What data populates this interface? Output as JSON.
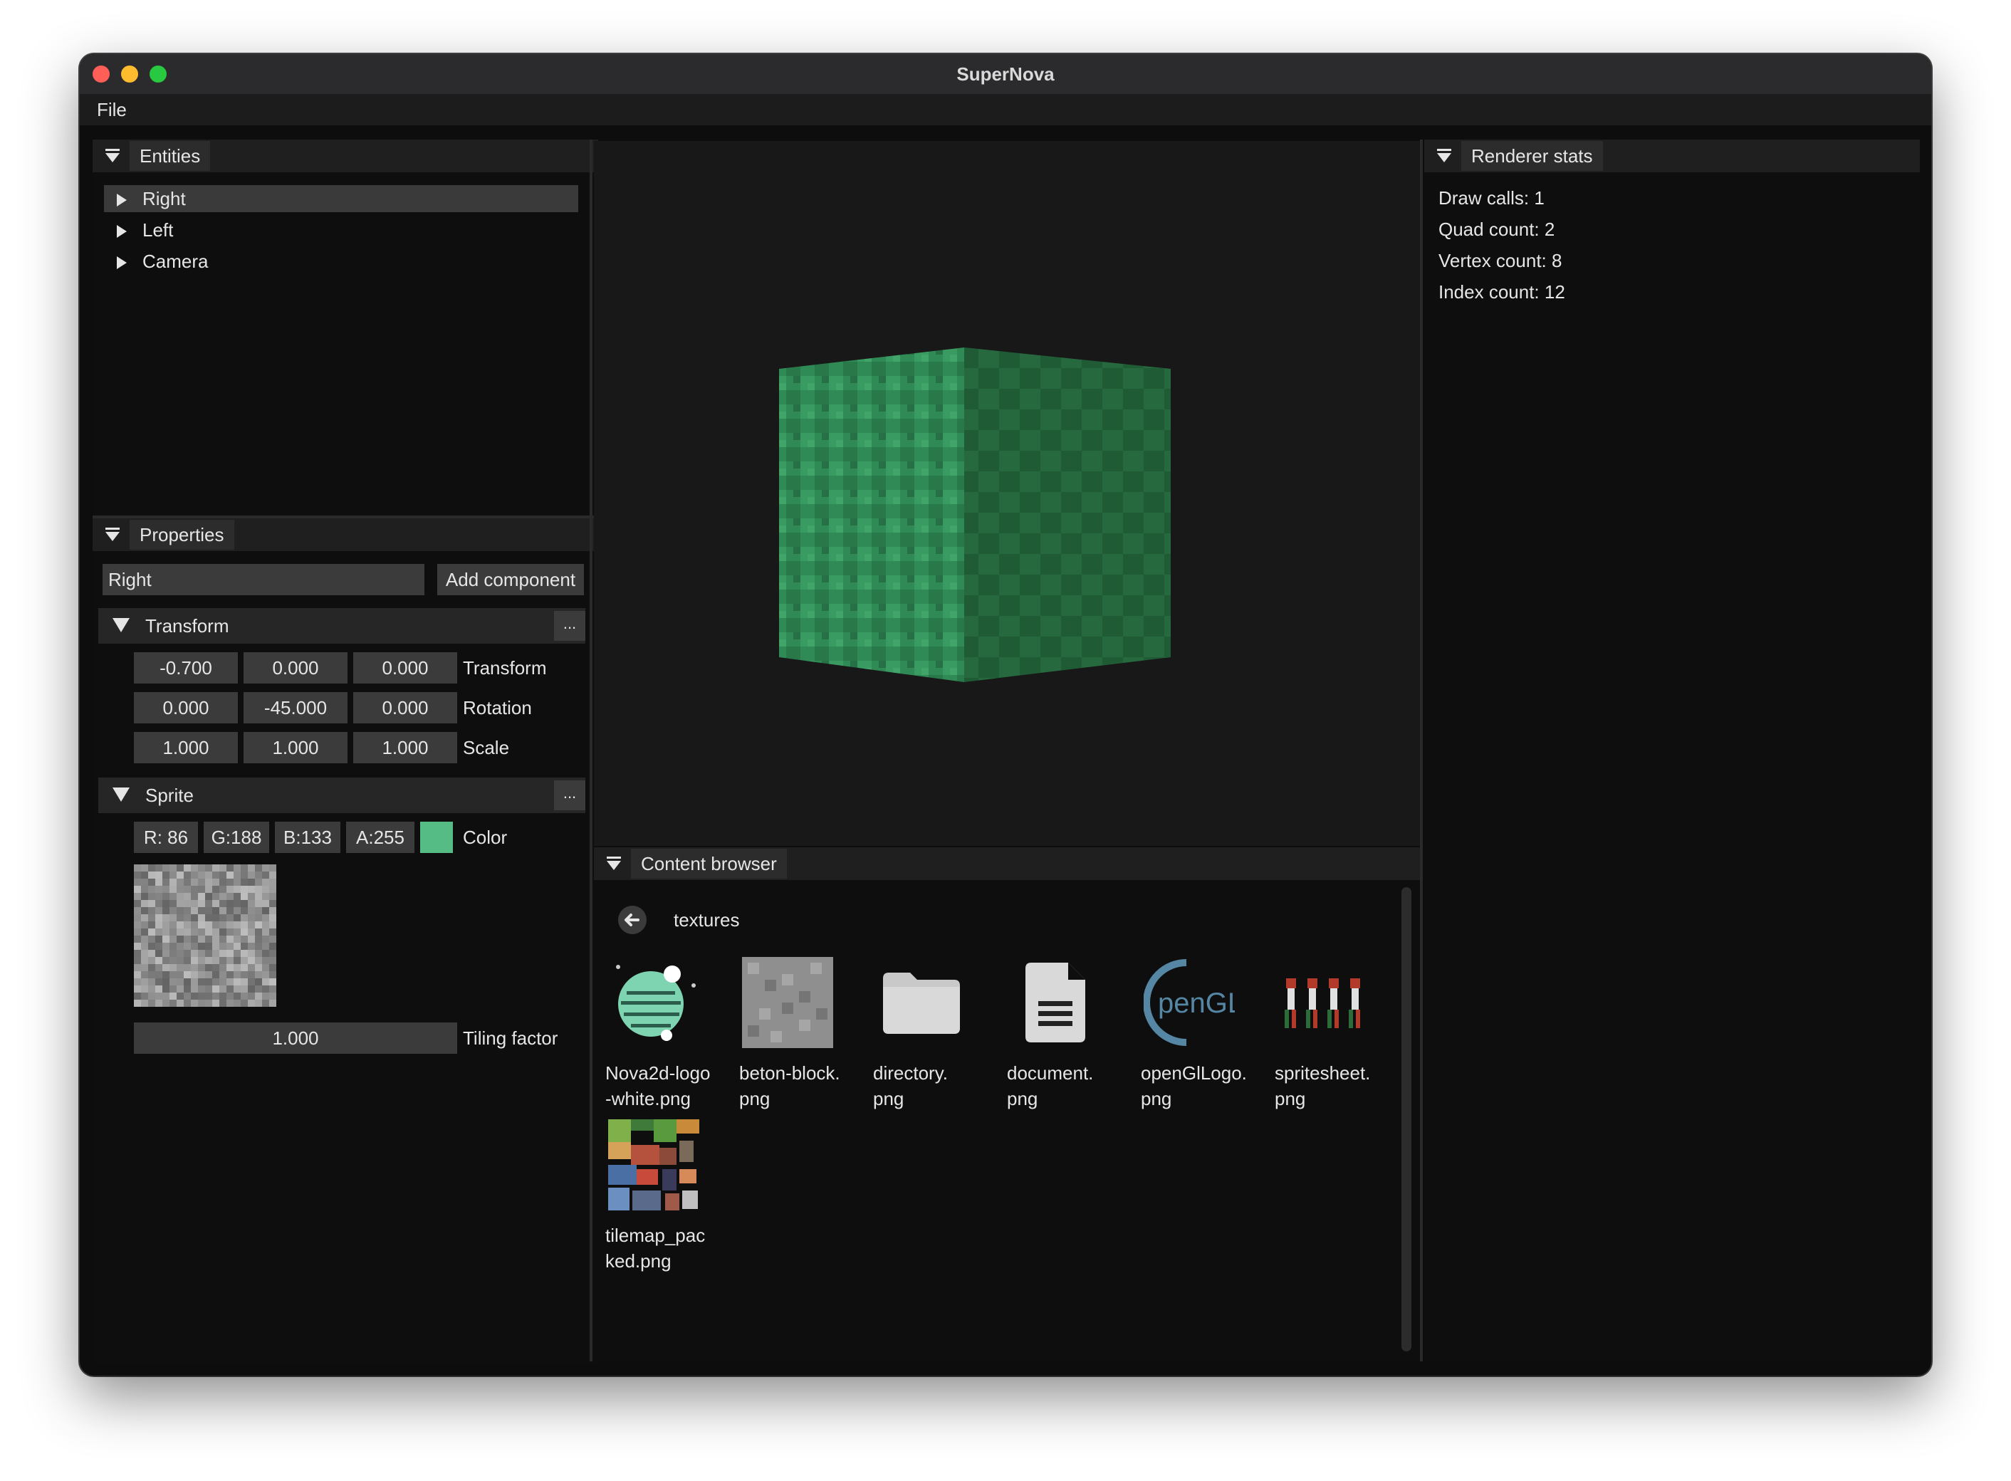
{
  "window": {
    "title": "SuperNova"
  },
  "menu": {
    "file": "File"
  },
  "entities": {
    "title": "Entities",
    "items": [
      "Right",
      "Left",
      "Camera"
    ]
  },
  "properties": {
    "title": "Properties",
    "name_value": "Right",
    "add_component": "Add component",
    "transform": {
      "title": "Transform",
      "more": "...",
      "rows": [
        {
          "label": "Transform",
          "values": [
            "-0.700",
            "0.000",
            "0.000"
          ]
        },
        {
          "label": "Rotation",
          "values": [
            "0.000",
            "-45.000",
            "0.000"
          ]
        },
        {
          "label": "Scale",
          "values": [
            "1.000",
            "1.000",
            "1.000"
          ]
        }
      ]
    },
    "sprite": {
      "title": "Sprite",
      "more": "...",
      "color_fields": [
        "R: 86",
        "G:188",
        "B:133",
        "A:255"
      ],
      "color_label": "Color",
      "color_hex": "#56bc85",
      "tiling_value": "1.000",
      "tiling_label": "Tiling factor"
    }
  },
  "content_browser": {
    "title": "Content browser",
    "folder": "textures",
    "assets": [
      {
        "name": "Nova2d-logo\n-white.png",
        "icon": "planet-logo-icon"
      },
      {
        "name": "beton-block.\npng",
        "icon": "concrete-texture-icon"
      },
      {
        "name": "directory.\npng",
        "icon": "folder-icon"
      },
      {
        "name": "document.\npng",
        "icon": "document-icon"
      },
      {
        "name": "openGlLogo.\npng",
        "icon": "opengl-logo-icon"
      },
      {
        "name": "spritesheet.\npng",
        "icon": "spritesheet-icon"
      },
      {
        "name": "tilemap_pac\nked.png",
        "icon": "tilemap-icon"
      }
    ]
  },
  "renderer_stats": {
    "title": "Renderer stats",
    "lines": [
      "Draw calls: 1",
      "Quad count: 2",
      "Vertex count: 8",
      "Index count: 12"
    ]
  },
  "colors": {
    "cube_left": "#2f8a55",
    "cube_right": "#1f5c36",
    "accent_green": "#56bc85"
  }
}
